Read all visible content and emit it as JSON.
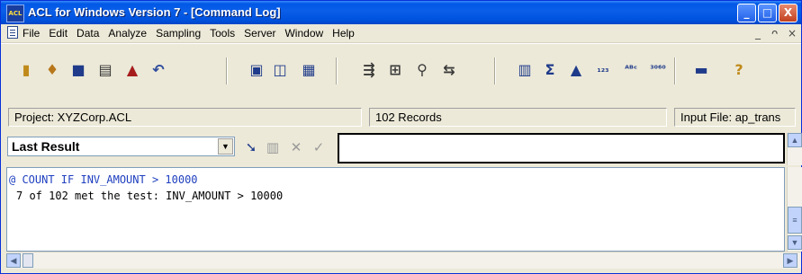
{
  "window": {
    "app_icon_text": "ACL",
    "title": "ACL for Windows Version 7 - [Command Log]",
    "controls": {
      "minimize": "_",
      "maximize": "□",
      "close": "X"
    }
  },
  "menu": {
    "items": [
      "File",
      "Edit",
      "Data",
      "Analyze",
      "Sampling",
      "Tools",
      "Server",
      "Window",
      "Help"
    ],
    "mdi_controls": {
      "minimize": "_",
      "restore": "ᴖ",
      "close": "×"
    }
  },
  "toolbar": {
    "icons": [
      {
        "name": "open-project-icon",
        "glyph": "▮",
        "color": "#c08a1a"
      },
      {
        "name": "open-table-icon",
        "glyph": "♦",
        "color": "#b7771a"
      },
      {
        "name": "save-icon",
        "glyph": "■",
        "color": "#1f3b8a"
      },
      {
        "name": "print-icon",
        "glyph": "▤",
        "color": "#333333"
      },
      {
        "name": "notes-icon",
        "glyph": "▲",
        "color": "#a61c1c"
      },
      {
        "name": "undo-icon",
        "glyph": "↶",
        "color": "#2f4c9c"
      },
      {
        "name": "view-first-icon",
        "glyph": "▣",
        "color": "#1f3b8a"
      },
      {
        "name": "view-mid-icon",
        "glyph": "◫",
        "color": "#1f3b8a"
      },
      {
        "name": "view-grid-icon",
        "glyph": "▦",
        "color": "#1f3b8a"
      },
      {
        "name": "extract-icon",
        "glyph": "⇶",
        "color": "#3a3a3a"
      },
      {
        "name": "join-icon",
        "glyph": "⊞",
        "color": "#3a3a3a"
      },
      {
        "name": "relate-icon",
        "glyph": "⚲",
        "color": "#3a3a3a"
      },
      {
        "name": "merge-icon",
        "glyph": "⇆",
        "color": "#3a3a3a"
      },
      {
        "name": "statistics-icon",
        "glyph": "▥",
        "color": "#1f3b8a"
      },
      {
        "name": "total-icon",
        "glyph": "Σ",
        "color": "#1f3b8a"
      },
      {
        "name": "stratify-icon",
        "glyph": "▲",
        "color": "#1f3b8a"
      },
      {
        "name": "sequence-icon",
        "glyph": "₁₂₃",
        "color": "#1f3b8a"
      },
      {
        "name": "classify-icon",
        "glyph": "ᴬᴮᶜ",
        "color": "#1f3b8a"
      },
      {
        "name": "age-icon",
        "glyph": "³⁰⁶⁰",
        "color": "#1f3b8a"
      },
      {
        "name": "gaps-icon",
        "glyph": "▬",
        "color": "#1f3b8a"
      },
      {
        "name": "help-icon",
        "glyph": "?",
        "color": "#c08a1a"
      }
    ]
  },
  "status": {
    "project": "Project: XYZCorp.ACL",
    "records": "102 Records",
    "input_file": "Input File: ap_trans"
  },
  "command": {
    "dropdown_value": "Last Result",
    "input_value": ""
  },
  "log": {
    "command_line": "@ COUNT IF INV_AMOUNT > 10000",
    "result_line": "7 of 102 met the test: INV_AMOUNT > 10000"
  }
}
